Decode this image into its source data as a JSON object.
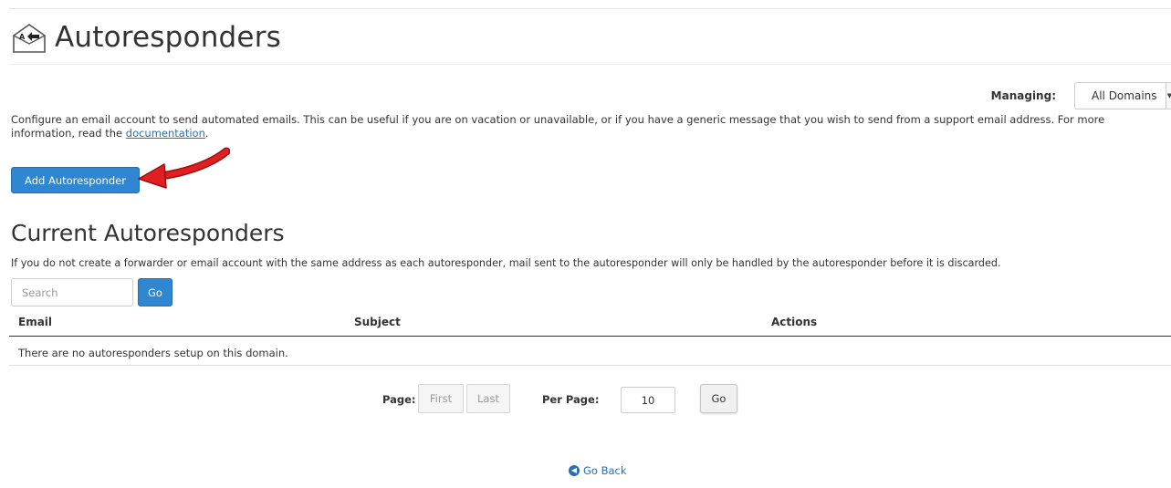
{
  "header": {
    "title": "Autoresponders",
    "icon": "autoresponder-envelope-icon"
  },
  "managing": {
    "label": "Managing:",
    "selected": "All Domains"
  },
  "intro": {
    "text": "Configure an email account to send automated emails. This can be useful if you are on vacation or unavailable, or if you have a generic message that you wish to send from a support email address. For more information, read the ",
    "link_label": "documentation",
    "suffix": "."
  },
  "actions": {
    "add_label": "Add Autoresponder"
  },
  "current": {
    "title": "Current Autoresponders",
    "note": "If you do not create a forwarder or email account with the same address as each autoresponder, mail sent to the autoresponder will only be handled by the autoresponder before it is discarded."
  },
  "search": {
    "placeholder": "Search",
    "go_label": "Go"
  },
  "table": {
    "columns": [
      "Email",
      "Subject",
      "Actions"
    ],
    "empty_message": "There are no autoresponders setup on this domain."
  },
  "pagination": {
    "page_label": "Page:",
    "first_label": "First",
    "last_label": "Last",
    "per_page_label": "Per Page:",
    "per_page_value": "10",
    "go_label": "Go"
  },
  "footer": {
    "go_back_label": "Go Back"
  },
  "colors": {
    "primary": "#2f86d1",
    "link": "#2a6fb2",
    "arrow": "#e02020"
  }
}
